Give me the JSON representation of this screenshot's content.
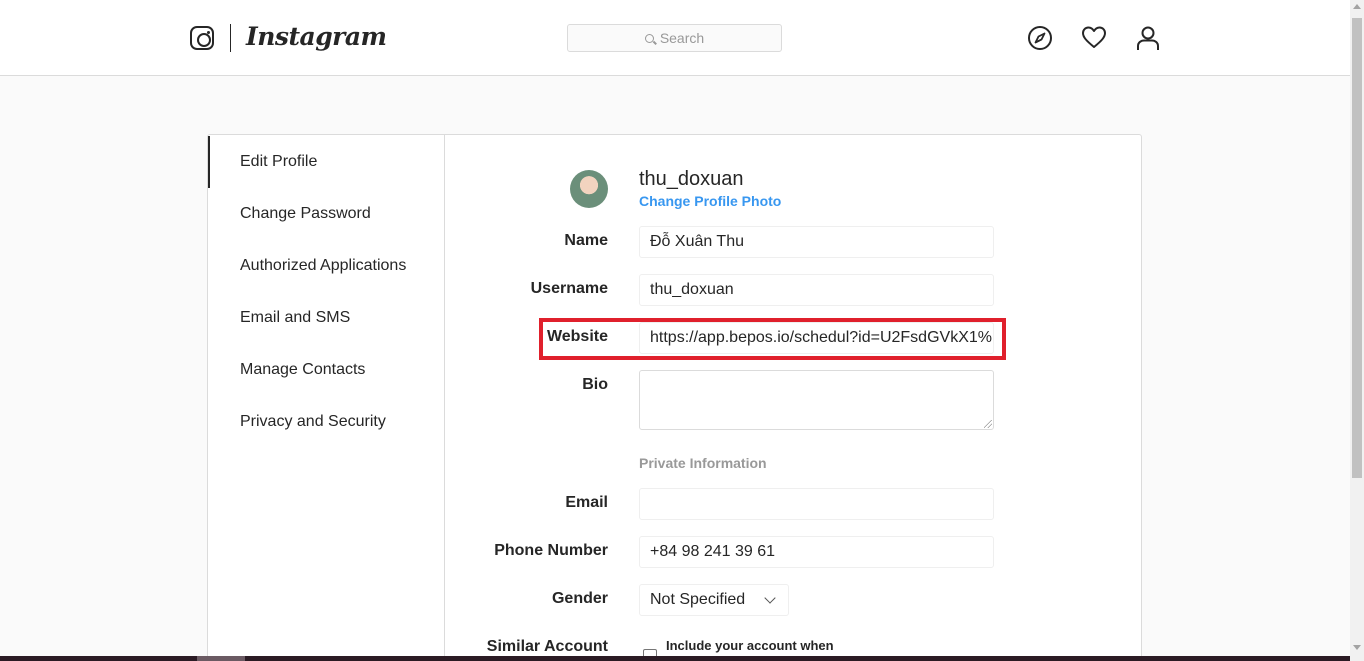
{
  "header": {
    "wordmark": "Instagram",
    "search_placeholder": "Search",
    "icons": [
      "instagram-glyph-icon",
      "compass-icon",
      "heart-icon",
      "person-icon"
    ]
  },
  "sidebar": {
    "items": [
      {
        "label": "Edit Profile",
        "active": true
      },
      {
        "label": "Change Password",
        "active": false
      },
      {
        "label": "Authorized Applications",
        "active": false
      },
      {
        "label": "Email and SMS",
        "active": false
      },
      {
        "label": "Manage Contacts",
        "active": false
      },
      {
        "label": "Privacy and Security",
        "active": false
      }
    ]
  },
  "profile": {
    "username": "thu_doxuan",
    "change_photo_label": "Change Profile Photo"
  },
  "form": {
    "name_label": "Name",
    "name_value": "Đỗ Xuân Thu",
    "username_label": "Username",
    "username_value": "thu_doxuan",
    "website_label": "Website",
    "website_value": "https://app.bepos.io/schedul?id=U2FsdGVkX1%",
    "bio_label": "Bio",
    "bio_value": "",
    "private_heading": "Private Information",
    "email_label": "Email",
    "email_value": "",
    "phone_label": "Phone Number",
    "phone_value": "+84 98 241 39 61",
    "gender_label": "Gender",
    "gender_value": "Not Specified",
    "similar_label": "Similar Account",
    "similar_text": "Include your account when"
  },
  "colors": {
    "link": "#3897f0",
    "highlight": "#e0202c",
    "border": "#dbdbdb"
  }
}
